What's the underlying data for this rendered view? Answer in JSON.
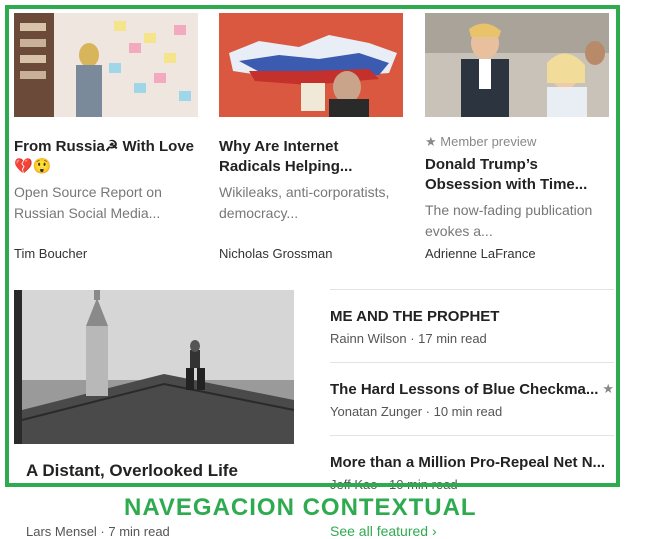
{
  "cards": [
    {
      "title": "From Russia☭ With Love 💔😲",
      "description": "Open Source Report on Russian Social Media...",
      "author": "Tim Boucher"
    },
    {
      "title": "Why Are Internet Radicals Helping...",
      "description": "Wikileaks, anti-corporatists, democracy...",
      "author": "Nicholas Grossman"
    },
    {
      "member_label": "Member preview",
      "title": "Donald Trump’s Obsession with Time...",
      "description": "The now-fading publication evokes a...",
      "author": "Adrienne LaFrance"
    }
  ],
  "featured": {
    "title": "A Distant, Overlooked Life",
    "author": "Lars Mensel · 7 min read"
  },
  "list": [
    {
      "title": "ME AND THE PROPHET",
      "meta": "Rainn Wilson · 17 min read"
    },
    {
      "title": "The Hard Lessons of Blue Checkma...",
      "meta": "Yonatan Zunger · 10 min read",
      "starred": true
    },
    {
      "title": "More than a Million Pro-Repeal Net N...",
      "meta": "Jeff Kao · 10 min read"
    }
  ],
  "see_all": "See all featured ›",
  "annotation_label": "NAVEGACION CONTEXTUAL",
  "star_glyph": "★",
  "colors": {
    "accent": "#2eaa4f"
  }
}
